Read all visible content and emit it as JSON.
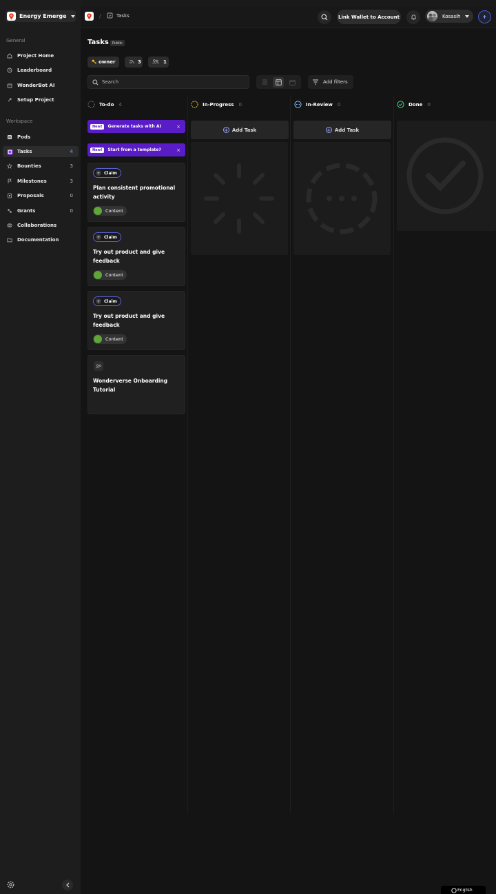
{
  "org": {
    "name": "Energy Emerge F..."
  },
  "sidebar": {
    "general_label": "General",
    "general_items": [
      {
        "label": "Project Home",
        "icon": "home-icon"
      },
      {
        "label": "Leaderboard",
        "icon": "leaderboard-icon"
      },
      {
        "label": "WonderBot AI",
        "icon": "bot-icon"
      },
      {
        "label": "Setup Project",
        "icon": "rocket-icon"
      }
    ],
    "workspace_label": "Workspace",
    "workspace_items": [
      {
        "label": "Pods",
        "count": "",
        "icon": "pods-icon"
      },
      {
        "label": "Tasks",
        "count": "4",
        "icon": "tasks-icon"
      },
      {
        "label": "Bounties",
        "count": "3",
        "icon": "star-icon"
      },
      {
        "label": "Milestones",
        "count": "3",
        "icon": "flag-icon"
      },
      {
        "label": "Proposals",
        "count": "0",
        "icon": "proposal-icon"
      },
      {
        "label": "Grants",
        "count": "0",
        "icon": "grants-icon"
      },
      {
        "label": "Collaborations",
        "count": "",
        "icon": "collab-icon"
      },
      {
        "label": "Documentation",
        "count": "",
        "icon": "folder-icon"
      }
    ]
  },
  "header": {
    "breadcrumb_sep": "/",
    "breadcrumb_current": "Tasks",
    "link_wallet": "Link Wallet to Account",
    "user_name": "Kosasih"
  },
  "page": {
    "title": "Tasks",
    "visibility": "Public",
    "role_chip": "owner",
    "pods_count": "3",
    "members_count": "1",
    "search_placeholder": "Search",
    "filters_label": "Add filters"
  },
  "columns": [
    {
      "name": "To-do",
      "count": "4"
    },
    {
      "name": "In-Progress",
      "count": "0"
    },
    {
      "name": "In-Review",
      "count": "0"
    },
    {
      "name": "Done",
      "count": "0"
    }
  ],
  "promos": [
    {
      "badge": "New!",
      "label": "Generate tasks with AI",
      "close": "×"
    },
    {
      "badge": "New!",
      "label": "Start from a template?",
      "close": "×"
    }
  ],
  "cards": [
    {
      "claim": "Claim",
      "title": "Plan consistent promotional activity",
      "tag": "Content"
    },
    {
      "claim": "Claim",
      "title": "Try out product and give feedback",
      "tag": "Content"
    },
    {
      "claim": "Claim",
      "title": "Try out product and give feedback",
      "tag": "Content"
    },
    {
      "title": "Wonderverse Onboarding Tutorial"
    }
  ],
  "add_task_label": "Add Task",
  "language": "English",
  "colors": {
    "accent": "#5a1cc7",
    "tag_green": "#5fa53a",
    "outline_blue": "#5a62d6"
  }
}
